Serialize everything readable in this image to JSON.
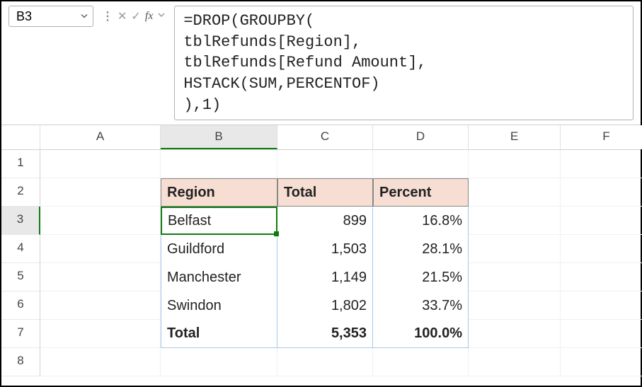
{
  "nameBox": {
    "value": "B3"
  },
  "formulaBar": {
    "text": "=DROP(GROUPBY(\ntblRefunds[Region],\ntblRefunds[Refund Amount],\nHSTACK(SUM,PERCENTOF)\n),1)"
  },
  "columns": [
    "A",
    "B",
    "C",
    "D",
    "E",
    "F"
  ],
  "activeColumn": "B",
  "rowNumbers": [
    "1",
    "2",
    "3",
    "4",
    "5",
    "6",
    "7",
    "8"
  ],
  "activeRow": "3",
  "table": {
    "headers": {
      "region": "Region",
      "total": "Total",
      "percent": "Percent"
    },
    "rows": [
      {
        "region": "Belfast",
        "total": "899",
        "percent": "16.8%"
      },
      {
        "region": "Guildford",
        "total": "1,503",
        "percent": "28.1%"
      },
      {
        "region": "Manchester",
        "total": "1,149",
        "percent": "21.5%"
      },
      {
        "region": "Swindon",
        "total": "1,802",
        "percent": "33.7%"
      }
    ],
    "footer": {
      "label": "Total",
      "total": "5,353",
      "percent": "100.0%"
    }
  }
}
